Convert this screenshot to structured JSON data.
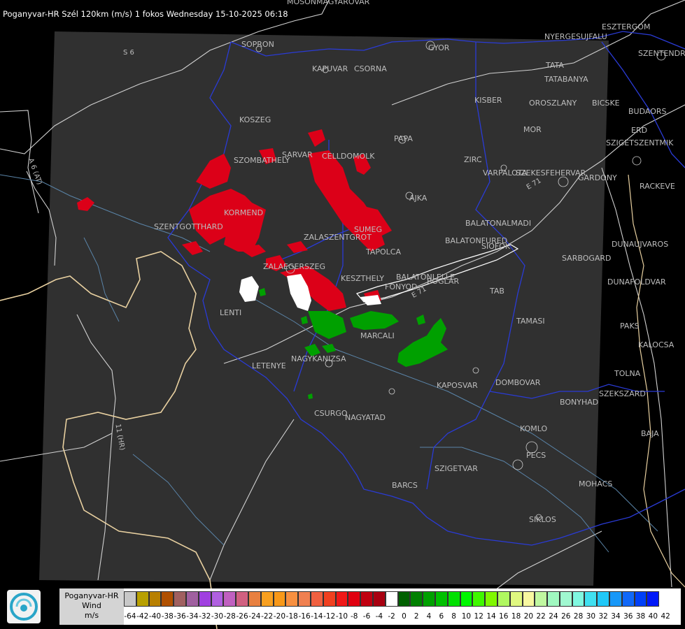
{
  "header": {
    "title": "Poganyvar-HR Szél 120km (m/s) 1 fokos Wednesday 15-10-2025 06:18"
  },
  "colors": {
    "background": "#000000",
    "radar_area": "#303030",
    "border": "#2a3bd6",
    "rivers": "#5a84a8",
    "roads": "#d8d8d8",
    "coast_line": "#e8d0a0"
  },
  "cities": [
    {
      "name": "SOPRON"
    },
    {
      "name": "MOSONMAGYAROVAR"
    },
    {
      "name": "KAPUVAR"
    },
    {
      "name": "CSORNA"
    },
    {
      "name": "GYOR"
    },
    {
      "name": "ESZTERGOM"
    },
    {
      "name": "NYERGESUJFALU"
    },
    {
      "name": "SZENTENDRE"
    },
    {
      "name": "TATA"
    },
    {
      "name": "TATABANYA"
    },
    {
      "name": "KISBER"
    },
    {
      "name": "OROSZLANY"
    },
    {
      "name": "BICSKE"
    },
    {
      "name": "BUDAORS"
    },
    {
      "name": "ERD"
    },
    {
      "name": "SZIGETSZENTMIK"
    },
    {
      "name": "MOR"
    },
    {
      "name": "KOSZEG"
    },
    {
      "name": "PAPA"
    },
    {
      "name": "SARVAR"
    },
    {
      "name": "CELLDOMOLK"
    },
    {
      "name": "SZOMBATHELY"
    },
    {
      "name": "ZIRC"
    },
    {
      "name": "VARPALOTA"
    },
    {
      "name": "SZEKESFEHERVAR"
    },
    {
      "name": "GARDONY"
    },
    {
      "name": "RACKEVE"
    },
    {
      "name": "AJKA"
    },
    {
      "name": "KORMEND"
    },
    {
      "name": "SZENTGOTTHARD"
    },
    {
      "name": "BALATONALMADI"
    },
    {
      "name": "SUMEG"
    },
    {
      "name": "ZALASZENTGROT"
    },
    {
      "name": "BALATONFURED"
    },
    {
      "name": "SIOFOK"
    },
    {
      "name": "TAPOLCA"
    },
    {
      "name": "DUNAUJVAROS"
    },
    {
      "name": "SARBOGARD"
    },
    {
      "name": "ZALAEGERSZEG"
    },
    {
      "name": "BALATONLELLE"
    },
    {
      "name": "KESZTHELY"
    },
    {
      "name": "FONYOD"
    },
    {
      "name": "BOGLAR"
    },
    {
      "name": "DUNAFOLDVAR"
    },
    {
      "name": "TAB"
    },
    {
      "name": "LENTI"
    },
    {
      "name": "TAMASI"
    },
    {
      "name": "PAKS"
    },
    {
      "name": "MARCALI"
    },
    {
      "name": "KALOCSA"
    },
    {
      "name": "LETENYE"
    },
    {
      "name": "NAGYKANIZSA"
    },
    {
      "name": "TOLNA"
    },
    {
      "name": "KAPOSVAR"
    },
    {
      "name": "DOMBOVAR"
    },
    {
      "name": "SZEKSZARD"
    },
    {
      "name": "BONYHAD"
    },
    {
      "name": "CSURGO"
    },
    {
      "name": "NAGYATAD"
    },
    {
      "name": "KOMLO"
    },
    {
      "name": "BAJA"
    },
    {
      "name": "PECS"
    },
    {
      "name": "SZIGETVAR"
    },
    {
      "name": "MOHACS"
    },
    {
      "name": "BARCS"
    },
    {
      "name": "SIKLOS"
    }
  ],
  "roads": [
    {
      "name": "S 6"
    },
    {
      "name": "A 6 (AT)"
    },
    {
      "name": "11 (HR)"
    },
    {
      "name": "E 71"
    },
    {
      "name": "E 71"
    }
  ],
  "legend": {
    "title_lines": [
      "Poganyvar-HR",
      "Wind",
      "m/s"
    ],
    "values": [
      "-64",
      "-42",
      "-40",
      "-38",
      "-36",
      "-34",
      "-32",
      "-30",
      "-28",
      "-26",
      "-24",
      "-22",
      "-20",
      "-18",
      "-16",
      "-14",
      "-12",
      "-10",
      "-8",
      "-6",
      "-4",
      "-2",
      "0",
      "2",
      "4",
      "6",
      "8",
      "10",
      "12",
      "14",
      "16",
      "18",
      "20",
      "22",
      "24",
      "26",
      "28",
      "30",
      "32",
      "34",
      "36",
      "38",
      "40",
      "42"
    ],
    "colors": [
      "#c8c8c8",
      "#b8a000",
      "#b88000",
      "#b05000",
      "#a06060",
      "#a060a0",
      "#a040e0",
      "#b060e0",
      "#c060c0",
      "#d06080",
      "#e88040",
      "#f8a020",
      "#f89818",
      "#f89040",
      "#f08050",
      "#f06040",
      "#f04020",
      "#f01818",
      "#e00010",
      "#c00010",
      "#a80010",
      "#ffffff",
      "#006000",
      "#008000",
      "#00a000",
      "#00c000",
      "#00e000",
      "#00f800",
      "#40f800",
      "#80f800",
      "#b0f860",
      "#e0f880",
      "#f8f8a0",
      "#c0f8a0",
      "#a0f8c0",
      "#a0f8d0",
      "#80f8e0",
      "#40e0f0",
      "#20c8f8",
      "#1898f8",
      "#1068f8",
      "#0040f8",
      "#0018f8"
    ]
  }
}
